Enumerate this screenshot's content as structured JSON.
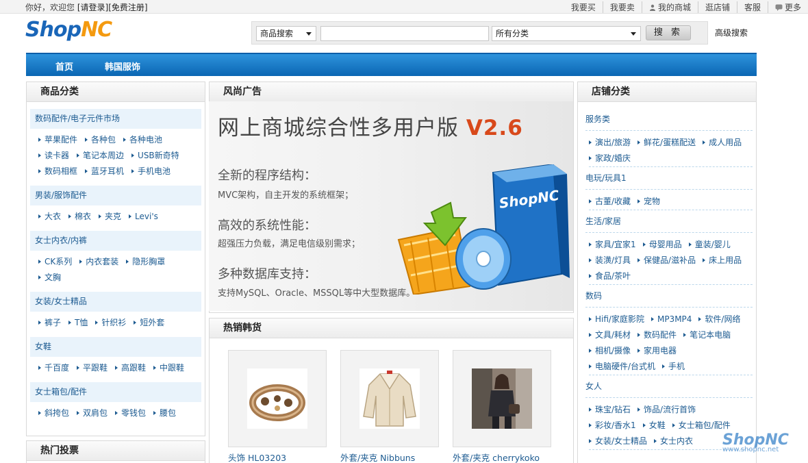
{
  "topbar": {
    "greeting": "你好，欢迎您",
    "login": "[请登录]",
    "register": "[免费注册]",
    "links": [
      "我要买",
      "我要卖",
      "我的商城",
      "逛店铺",
      "客服",
      "更多"
    ]
  },
  "logo": {
    "part1": "Shop",
    "part2": "NC"
  },
  "search": {
    "type_selected": "商品搜索",
    "keyword_value": "",
    "category_selected": "所有分类",
    "button_label": "搜 索",
    "advanced_label": "高级搜索"
  },
  "nav": [
    "首页",
    "韩国服饰"
  ],
  "left_panel": {
    "title": "商品分类",
    "categories": [
      {
        "name": "数码配件/电子元件市场",
        "items": [
          "苹果配件",
          "各种包",
          "各种电池",
          "读卡器",
          "笔记本周边",
          "USB新奇特",
          "数码相框",
          "蓝牙耳机",
          "手机电池"
        ]
      },
      {
        "name": "男装/服饰配件",
        "items": [
          "大衣",
          "棉衣",
          "夹克",
          "Levi's"
        ]
      },
      {
        "name": "女士内衣/内裤",
        "items": [
          "CK系列",
          "内衣套装",
          "隐形胸罩",
          "文胸"
        ]
      },
      {
        "name": "女装/女士精品",
        "items": [
          "裤子",
          "T恤",
          "针织衫",
          "短外套"
        ]
      },
      {
        "name": "女鞋",
        "items": [
          "千百度",
          "平跟鞋",
          "高跟鞋",
          "中跟鞋"
        ]
      },
      {
        "name": "女士箱包/配件",
        "items": [
          "斜挎包",
          "双肩包",
          "零钱包",
          "腰包"
        ]
      }
    ]
  },
  "poll_panel": {
    "title": "热门投票"
  },
  "ad_panel": {
    "title": "风尚广告",
    "banner": {
      "headline": "网上商城综合性多用户版",
      "version": "V2.6",
      "points": [
        {
          "heading": "全新的程序结构：",
          "detail": "MVC架构，自主开发的系统框架；"
        },
        {
          "heading": "高效的系统性能：",
          "detail": "超强压力负载，满足电信级别需求；"
        },
        {
          "heading": "多种数据库支持：",
          "detail": "支持MySQL、Oracle、MSSQL等中大型数据库。"
        }
      ],
      "box_text": "ShopNC"
    }
  },
  "hot_panel": {
    "title": "热销韩货",
    "goods": [
      {
        "label": "头饰  HL03203"
      },
      {
        "label": "外套/夹克  Nibbuns"
      },
      {
        "label": "外套/夹克  cherrykoko"
      }
    ]
  },
  "right_panel": {
    "title": "店铺分类",
    "groups": [
      {
        "name": "服务类",
        "items": [
          "演出/旅游",
          "鲜花/蛋糕配送",
          "成人用品",
          "家政/婚庆"
        ]
      },
      {
        "name": "电玩/玩具1",
        "items": [
          "古董/收藏",
          "宠物"
        ]
      },
      {
        "name": "生活/家居",
        "items": [
          "家具/宜家1",
          "母婴用品",
          "童装/婴儿",
          "装潢/灯具",
          "保健品/滋补品",
          "床上用品",
          "食品/茶叶"
        ]
      },
      {
        "name": "数码",
        "items": [
          "Hifi/家庭影院",
          "MP3MP4",
          "软件/网络",
          "文具/耗材",
          "数码配件",
          "笔记本电脑",
          "相机/摄像",
          "家用电器",
          "电脑硬件/台式机",
          "手机"
        ]
      },
      {
        "name": "女人",
        "items": [
          "珠宝/钻石",
          "饰品/流行首饰",
          "彩妆/香水1",
          "女鞋",
          "女士箱包/配件",
          "女装/女士精品",
          "女士内衣"
        ]
      }
    ]
  },
  "watermark": {
    "brand": "ShopNC",
    "url": "www.shopnc.net"
  },
  "colors": {
    "nav_blue": "#0a66b3",
    "link_blue": "#1d5b91",
    "logo_blue": "#1a66b8",
    "logo_orange": "#f49a10",
    "version_orange": "#d8491b"
  }
}
